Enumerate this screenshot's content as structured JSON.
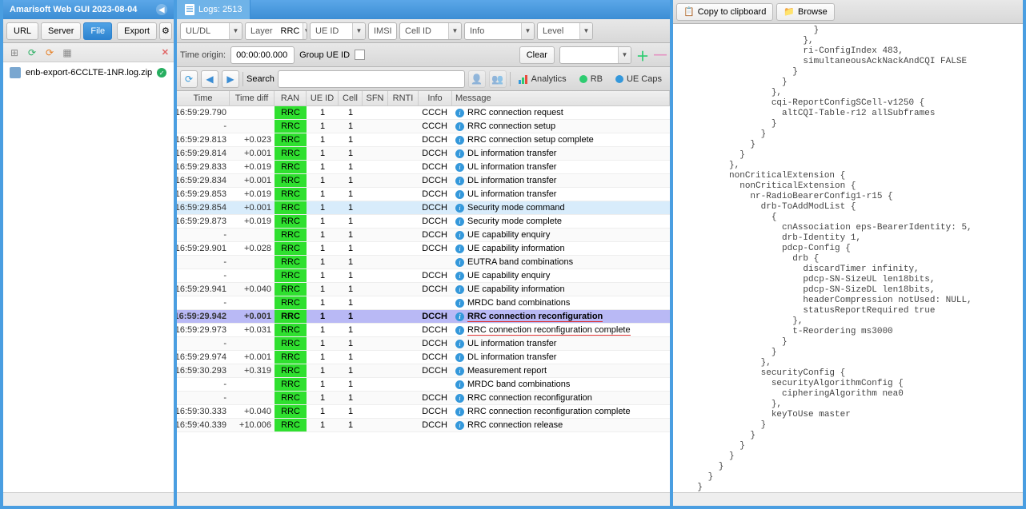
{
  "left": {
    "title": "Amarisoft Web GUI 2023-08-04",
    "buttons": {
      "url": "URL",
      "server": "Server",
      "file": "File",
      "export": "Export"
    },
    "file_name": "enb-export-6CCLTE-1NR.log.zip"
  },
  "center": {
    "tab_label": "Logs: 2513",
    "filters": {
      "uldl": {
        "label": "UL/DL",
        "value": ""
      },
      "layer": {
        "label": "Layer",
        "value": "RRC"
      },
      "ueid": {
        "label": "UE ID",
        "value": ""
      },
      "imsi": {
        "label": "IMSI",
        "value": ""
      },
      "cellid": {
        "label": "Cell ID",
        "value": ""
      },
      "info": {
        "label": "Info",
        "value": ""
      },
      "level": {
        "label": "Level",
        "value": ""
      }
    },
    "time_origin_label": "Time origin:",
    "time_origin_value": "00:00:00.000",
    "group_ue_id_label": "Group UE ID",
    "clear_label": "Clear",
    "search_label": "Search",
    "links": {
      "analytics": "Analytics",
      "rb": "RB",
      "ue_caps": "UE Caps"
    },
    "headers": {
      "time": "Time",
      "diff": "Time diff",
      "ran": "RAN",
      "ueid": "UE ID",
      "cell": "Cell",
      "sfn": "SFN",
      "rnti": "RNTI",
      "info": "Info",
      "msg": "Message"
    },
    "rows": [
      {
        "time": "16:59:29.790",
        "diff": "",
        "dir": "ul",
        "ran": "RRC",
        "ue": "1",
        "cell": "1",
        "info": "CCCH",
        "msg": "RRC connection request"
      },
      {
        "time": "-",
        "diff": "",
        "dir": "dl",
        "ran": "RRC",
        "ue": "1",
        "cell": "1",
        "info": "CCCH",
        "msg": "RRC connection setup"
      },
      {
        "time": "16:59:29.813",
        "diff": "+0.023",
        "dir": "ul",
        "ran": "RRC",
        "ue": "1",
        "cell": "1",
        "info": "DCCH",
        "msg": "RRC connection setup complete"
      },
      {
        "time": "16:59:29.814",
        "diff": "+0.001",
        "dir": "dl",
        "ran": "RRC",
        "ue": "1",
        "cell": "1",
        "info": "DCCH",
        "msg": "DL information transfer"
      },
      {
        "time": "16:59:29.833",
        "diff": "+0.019",
        "dir": "ul",
        "ran": "RRC",
        "ue": "1",
        "cell": "1",
        "info": "DCCH",
        "msg": "UL information transfer"
      },
      {
        "time": "16:59:29.834",
        "diff": "+0.001",
        "dir": "dl",
        "ran": "RRC",
        "ue": "1",
        "cell": "1",
        "info": "DCCH",
        "msg": "DL information transfer"
      },
      {
        "time": "16:59:29.853",
        "diff": "+0.019",
        "dir": "ul",
        "ran": "RRC",
        "ue": "1",
        "cell": "1",
        "info": "DCCH",
        "msg": "UL information transfer"
      },
      {
        "time": "16:59:29.854",
        "diff": "+0.001",
        "dir": "dl",
        "ran": "RRC",
        "ue": "1",
        "cell": "1",
        "info": "DCCH",
        "msg": "Security mode command",
        "hl": true
      },
      {
        "time": "16:59:29.873",
        "diff": "+0.019",
        "dir": "ul",
        "ran": "RRC",
        "ue": "1",
        "cell": "1",
        "info": "DCCH",
        "msg": "Security mode complete"
      },
      {
        "time": "-",
        "diff": "",
        "dir": "dl",
        "ran": "RRC",
        "ue": "1",
        "cell": "1",
        "info": "DCCH",
        "msg": "UE capability enquiry"
      },
      {
        "time": "16:59:29.901",
        "diff": "+0.028",
        "dir": "ul",
        "ran": "RRC",
        "ue": "1",
        "cell": "1",
        "info": "DCCH",
        "msg": "UE capability information"
      },
      {
        "time": "-",
        "diff": "",
        "dir": "",
        "ran": "RRC",
        "ue": "1",
        "cell": "1",
        "info": "",
        "msg": "EUTRA band combinations"
      },
      {
        "time": "-",
        "diff": "",
        "dir": "dl",
        "ran": "RRC",
        "ue": "1",
        "cell": "1",
        "info": "DCCH",
        "msg": "UE capability enquiry"
      },
      {
        "time": "16:59:29.941",
        "diff": "+0.040",
        "dir": "ul",
        "ran": "RRC",
        "ue": "1",
        "cell": "1",
        "info": "DCCH",
        "msg": "UE capability information"
      },
      {
        "time": "-",
        "diff": "",
        "dir": "",
        "ran": "RRC",
        "ue": "1",
        "cell": "1",
        "info": "",
        "msg": "MRDC band combinations"
      },
      {
        "time": "16:59:29.942",
        "diff": "+0.001",
        "dir": "dl",
        "ran": "RRC",
        "ue": "1",
        "cell": "1",
        "info": "DCCH",
        "msg": "RRC connection reconfiguration",
        "sel": true,
        "red": true
      },
      {
        "time": "16:59:29.973",
        "diff": "+0.031",
        "dir": "ul",
        "ran": "RRC",
        "ue": "1",
        "cell": "1",
        "info": "DCCH",
        "msg": "RRC connection reconfiguration complete",
        "red": true
      },
      {
        "time": "-",
        "diff": "",
        "dir": "ul",
        "ran": "RRC",
        "ue": "1",
        "cell": "1",
        "info": "DCCH",
        "msg": "UL information transfer"
      },
      {
        "time": "16:59:29.974",
        "diff": "+0.001",
        "dir": "dl",
        "ran": "RRC",
        "ue": "1",
        "cell": "1",
        "info": "DCCH",
        "msg": "DL information transfer"
      },
      {
        "time": "16:59:30.293",
        "diff": "+0.319",
        "dir": "ul",
        "ran": "RRC",
        "ue": "1",
        "cell": "1",
        "info": "DCCH",
        "msg": "Measurement report"
      },
      {
        "time": "-",
        "diff": "",
        "dir": "",
        "ran": "RRC",
        "ue": "1",
        "cell": "1",
        "info": "",
        "msg": "MRDC band combinations"
      },
      {
        "time": "-",
        "diff": "",
        "dir": "dl",
        "ran": "RRC",
        "ue": "1",
        "cell": "1",
        "info": "DCCH",
        "msg": "RRC connection reconfiguration"
      },
      {
        "time": "16:59:30.333",
        "diff": "+0.040",
        "dir": "ul",
        "ran": "RRC",
        "ue": "1",
        "cell": "1",
        "info": "DCCH",
        "msg": "RRC connection reconfiguration complete"
      },
      {
        "time": "16:59:40.339",
        "diff": "+10.006",
        "dir": "dl",
        "ran": "RRC",
        "ue": "1",
        "cell": "1",
        "info": "DCCH",
        "msg": "RRC connection release"
      }
    ]
  },
  "right": {
    "copy_label": "Copy to clipboard",
    "browse_label": "Browse",
    "detail": "                          }\n                        },\n                        ri-ConfigIndex 483,\n                        simultaneousAckNackAndCQI FALSE\n                      }\n                    }\n                  },\n                  cqi-ReportConfigSCell-v1250 {\n                    altCQI-Table-r12 allSubframes\n                  }\n                }\n              }\n            }\n          },\n          nonCriticalExtension {\n            nonCriticalExtension {\n              nr-RadioBearerConfig1-r15 {\n                drb-ToAddModList {\n                  {\n                    cnAssociation eps-BearerIdentity: 5,\n                    drb-Identity 1,\n                    pdcp-Config {\n                      drb {\n                        discardTimer infinity,\n                        pdcp-SN-SizeUL len18bits,\n                        pdcp-SN-SizeDL len18bits,\n                        headerCompression notUsed: NULL,\n                        statusReportRequired true\n                      },\n                      t-Reordering ms3000\n                    }\n                  }\n                },\n                securityConfig {\n                  securityAlgorithmConfig {\n                    cipheringAlgorithm nea0\n                  },\n                  keyToUse master\n                }\n              }\n            }\n          }\n        }\n      }\n    }\n  }\n}\n"
  }
}
